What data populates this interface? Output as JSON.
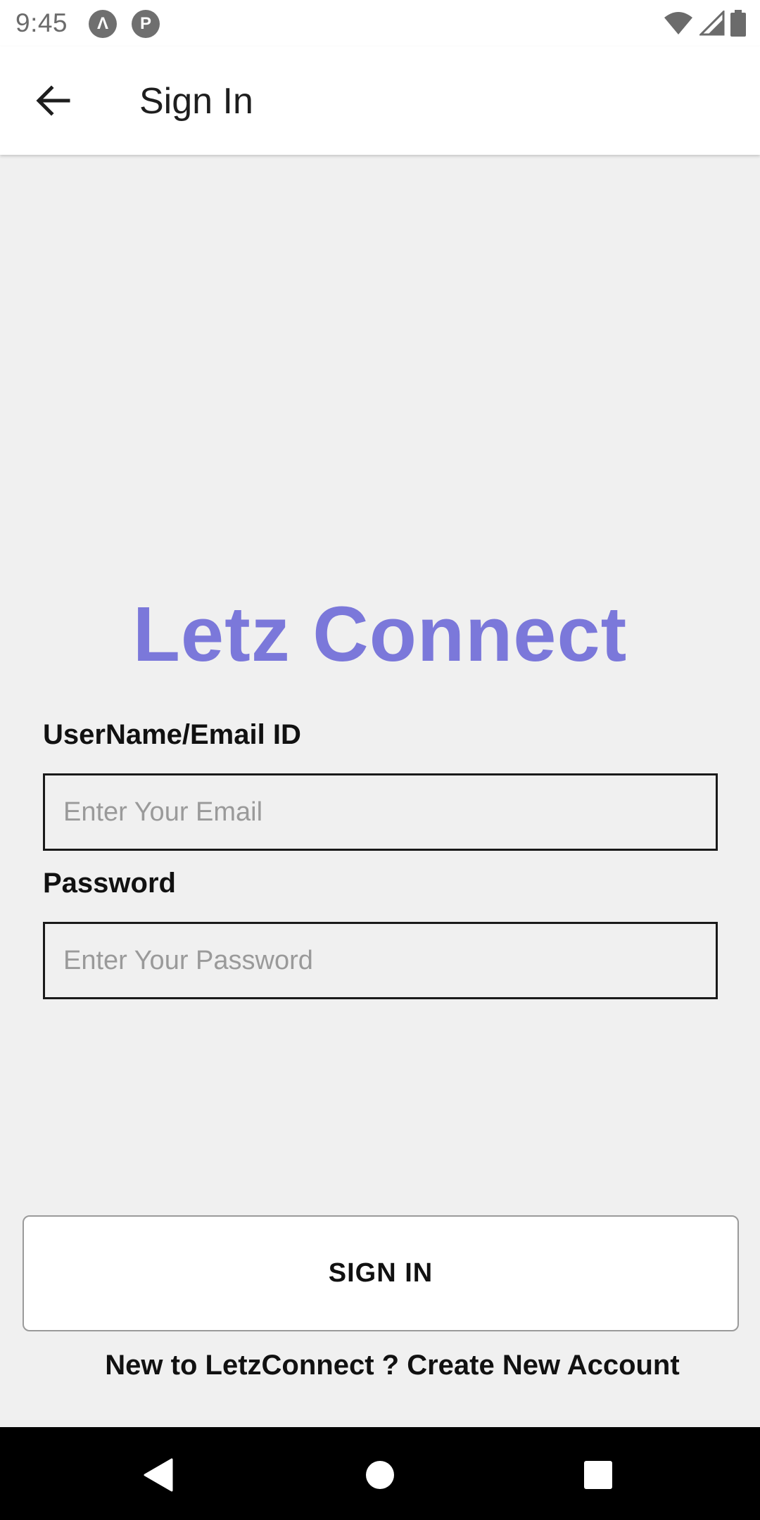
{
  "status_bar": {
    "time": "9:45",
    "notification_icons": [
      "app-a-icon",
      "app-p-icon"
    ],
    "right_icons": [
      "wifi-icon",
      "cell-signal-icon",
      "battery-icon"
    ]
  },
  "app_bar": {
    "title": "Sign In",
    "back_icon": "arrow-left-icon"
  },
  "brand": {
    "name": "Letz Connect",
    "color": "#7b78da"
  },
  "form": {
    "email_label": "UserName/Email ID",
    "email_placeholder": "Enter Your Email",
    "email_value": "",
    "password_label": "Password",
    "password_placeholder": "Enter Your Password",
    "password_value": ""
  },
  "actions": {
    "sign_in_label": "SIGN IN",
    "signup_prompt": "New to LetzConnect ? ",
    "signup_link": "Create New Account"
  },
  "nav_bar": {
    "buttons": [
      "back-triangle-icon",
      "home-circle-icon",
      "recents-square-icon"
    ]
  }
}
